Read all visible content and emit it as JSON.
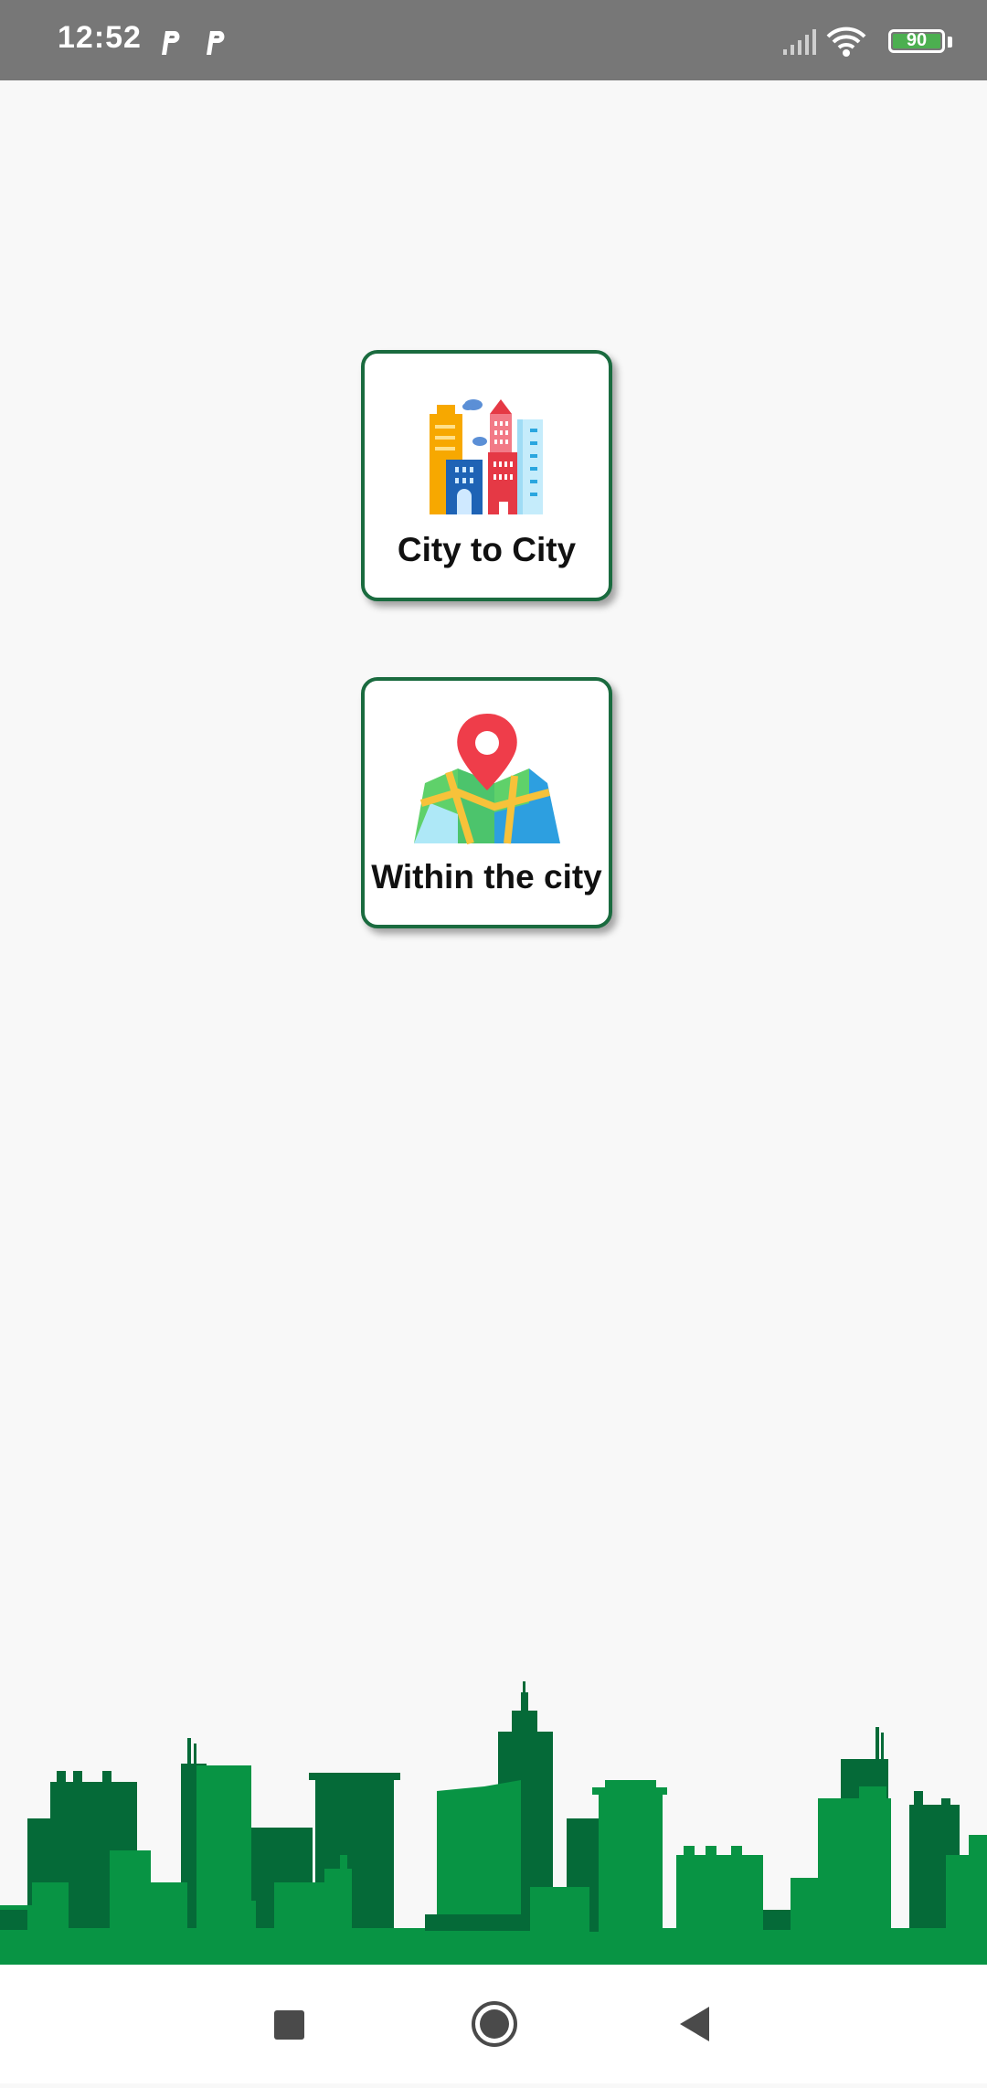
{
  "status_bar": {
    "time": "12:52",
    "battery_level": "90",
    "icons": [
      "parking-app-icon",
      "parking-app-icon",
      "signal-icon",
      "wifi-icon",
      "battery-icon"
    ]
  },
  "options": [
    {
      "label": "City to City",
      "icon": "city-buildings-icon"
    },
    {
      "label": "Within the city",
      "icon": "map-pin-icon"
    }
  ],
  "nav_bar": {
    "buttons": [
      "recents-square-icon",
      "home-circle-icon",
      "back-triangle-icon"
    ]
  },
  "colors": {
    "accent": "#1a6b3f",
    "skyline_light": "#089444",
    "skyline_dark": "#056a38",
    "status_bar": "#777777",
    "background": "#f8f8f8"
  }
}
